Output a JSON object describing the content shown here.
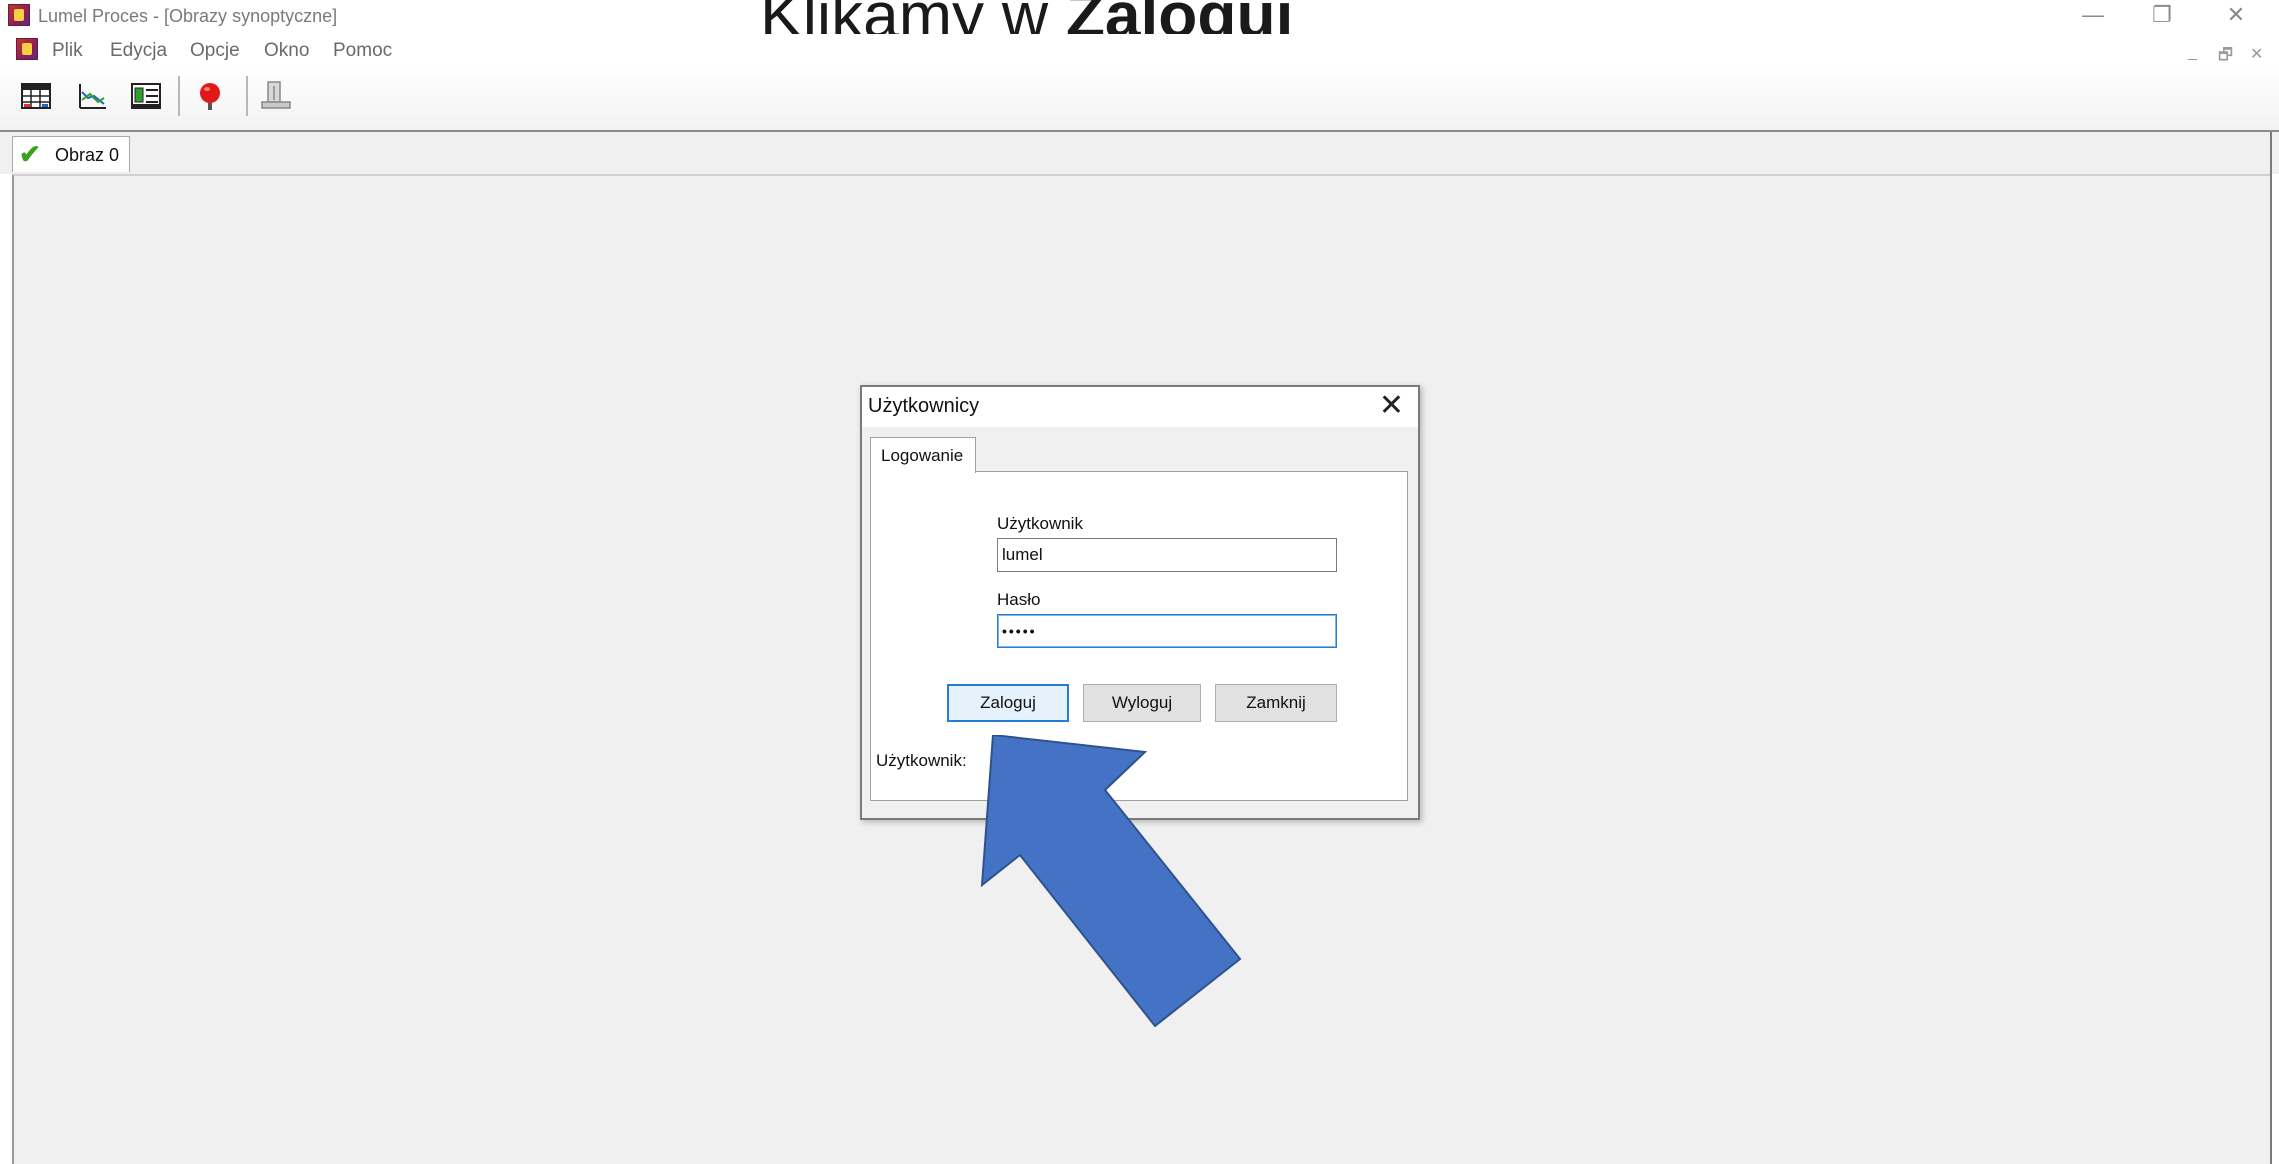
{
  "window": {
    "title": "Lumel Proces - [Obrazy synoptyczne]",
    "controls": {
      "minimize": "—",
      "restore": "❐",
      "close": "✕"
    },
    "mdi_controls": {
      "minimize": "_",
      "restore": "🗗",
      "close": "✕"
    }
  },
  "overlay": {
    "heading_prefix": "Klikamy w ",
    "heading_bold": "Zaloguj"
  },
  "menu": {
    "items": [
      "Plik",
      "Edycja",
      "Opcje",
      "Okno",
      "Pomoc"
    ]
  },
  "toolbar": {
    "buttons": [
      "table-icon",
      "chart-icon",
      "panel-icon",
      "alarm-icon",
      "printer-icon"
    ]
  },
  "document_tab": {
    "label": "Obraz 0"
  },
  "dialog": {
    "title": "Użytkownicy",
    "close_glyph": "✕",
    "tab_label": "Logowanie",
    "user_label": "Użytkownik",
    "user_value": "lumel",
    "password_label": "Hasło",
    "password_value": "•••••",
    "buttons": {
      "login": "Zaloguj",
      "logout": "Wyloguj",
      "close": "Zamknij"
    },
    "status_label": "Użytkownik:"
  },
  "colors": {
    "arrow": "#4472c4",
    "focus_border": "#2a7bd4"
  }
}
